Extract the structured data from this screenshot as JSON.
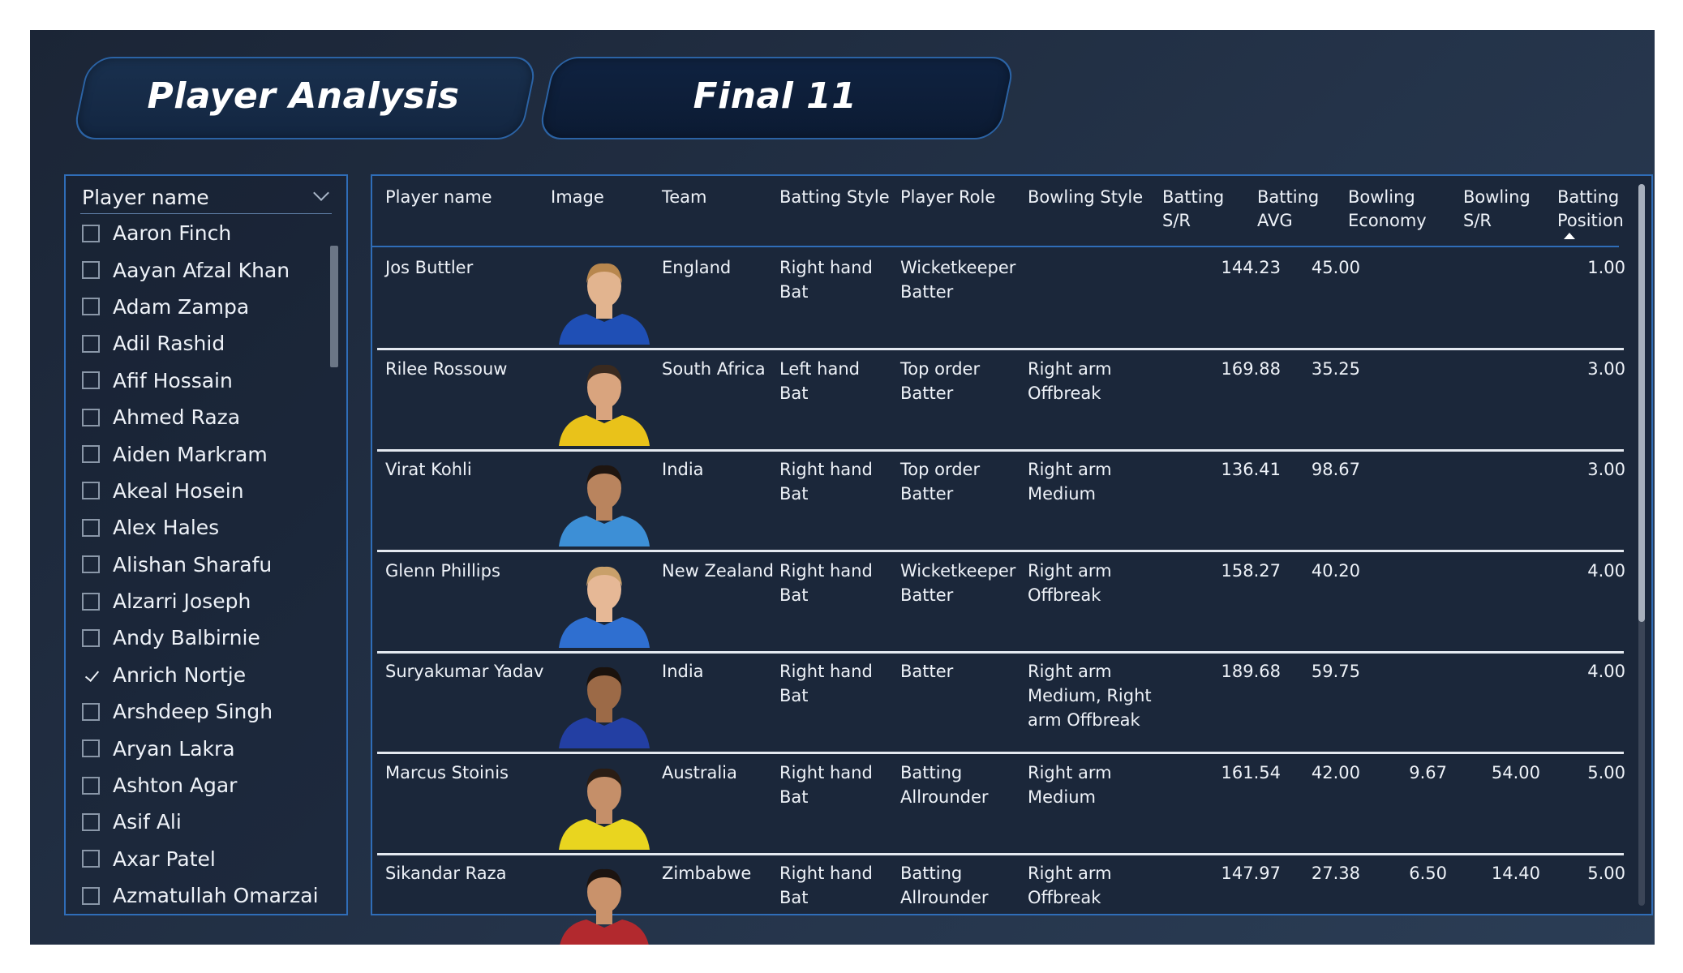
{
  "tabs": [
    {
      "label": "Player Analysis"
    },
    {
      "label": "Final 11"
    }
  ],
  "slicer": {
    "title": "Player name",
    "items": [
      {
        "label": "Aaron Finch",
        "checked": false
      },
      {
        "label": "Aayan Afzal Khan",
        "checked": false
      },
      {
        "label": "Adam Zampa",
        "checked": false
      },
      {
        "label": "Adil Rashid",
        "checked": false
      },
      {
        "label": "Afif Hossain",
        "checked": false
      },
      {
        "label": "Ahmed Raza",
        "checked": false
      },
      {
        "label": "Aiden Markram",
        "checked": false
      },
      {
        "label": "Akeal Hosein",
        "checked": false
      },
      {
        "label": "Alex Hales",
        "checked": false
      },
      {
        "label": "Alishan Sharafu",
        "checked": false
      },
      {
        "label": "Alzarri Joseph",
        "checked": false
      },
      {
        "label": "Andy Balbirnie",
        "checked": false
      },
      {
        "label": "Anrich Nortje",
        "checked": true
      },
      {
        "label": "Arshdeep Singh",
        "checked": false
      },
      {
        "label": "Aryan Lakra",
        "checked": false
      },
      {
        "label": "Ashton Agar",
        "checked": false
      },
      {
        "label": "Asif Ali",
        "checked": false
      },
      {
        "label": "Axar Patel",
        "checked": false
      },
      {
        "label": "Azmatullah Omarzai",
        "checked": false
      }
    ]
  },
  "table": {
    "columns": [
      [
        "Player name"
      ],
      [
        "Image"
      ],
      [
        "Team"
      ],
      [
        "Batting Style"
      ],
      [
        "Player Role"
      ],
      [
        "Bowling Style"
      ],
      [
        "Batting",
        "S/R"
      ],
      [
        "Batting",
        "AVG"
      ],
      [
        "Bowling",
        "Economy"
      ],
      [
        "Bowling",
        "S/R"
      ],
      [
        "Batting",
        "Position"
      ]
    ],
    "rows": [
      {
        "name": "Jos Buttler",
        "team": "England",
        "bat_style": [
          "Right hand",
          "Bat"
        ],
        "role": [
          "Wicketkeeper",
          "Batter"
        ],
        "bowl_style": [],
        "bat_sr": "144.23",
        "bat_avg": "45.00",
        "bowl_econ": "",
        "bowl_sr": "",
        "bat_pos": "1.00",
        "shirt": "#1f4fb5",
        "skin": "#e2b48f",
        "hair": "#b8874e"
      },
      {
        "name": "Rilee Rossouw",
        "team": "South Africa",
        "bat_style": [
          "Left hand",
          "Bat"
        ],
        "role": [
          "Top order",
          "Batter"
        ],
        "bowl_style": [
          "Right arm",
          "Offbreak"
        ],
        "bat_sr": "169.88",
        "bat_avg": "35.25",
        "bowl_econ": "",
        "bowl_sr": "",
        "bat_pos": "3.00",
        "shirt": "#e9c21a",
        "skin": "#d9a47e",
        "hair": "#3a2a1f"
      },
      {
        "name": "Virat Kohli",
        "team": "India",
        "bat_style": [
          "Right hand",
          "Bat"
        ],
        "role": [
          "Top order",
          "Batter"
        ],
        "bowl_style": [
          "Right arm",
          "Medium"
        ],
        "bat_sr": "136.41",
        "bat_avg": "98.67",
        "bowl_econ": "",
        "bowl_sr": "",
        "bat_pos": "3.00",
        "shirt": "#3d8fd6",
        "skin": "#b9845e",
        "hair": "#1e1510"
      },
      {
        "name": "Glenn Phillips",
        "team": "New Zealand",
        "bat_style": [
          "Right hand",
          "Bat"
        ],
        "role": [
          "Wicketkeeper",
          "Batter"
        ],
        "bowl_style": [
          "Right arm",
          "Offbreak"
        ],
        "bat_sr": "158.27",
        "bat_avg": "40.20",
        "bowl_econ": "",
        "bowl_sr": "",
        "bat_pos": "4.00",
        "shirt": "#2f6fd0",
        "skin": "#e6b896",
        "hair": "#c9a06a"
      },
      {
        "name": "Suryakumar Yadav",
        "team": "India",
        "bat_style": [
          "Right hand",
          "Bat"
        ],
        "role": [
          "Batter"
        ],
        "bowl_style": [
          "Right arm",
          "Medium, Right",
          "arm Offbreak"
        ],
        "bat_sr": "189.68",
        "bat_avg": "59.75",
        "bowl_econ": "",
        "bowl_sr": "",
        "bat_pos": "4.00",
        "shirt": "#233fa3",
        "skin": "#9c6a47",
        "hair": "#1a120d"
      },
      {
        "name": "Marcus Stoinis",
        "team": "Australia",
        "bat_style": [
          "Right hand",
          "Bat"
        ],
        "role": [
          "Batting",
          "Allrounder"
        ],
        "bowl_style": [
          "Right arm",
          "Medium"
        ],
        "bat_sr": "161.54",
        "bat_avg": "42.00",
        "bowl_econ": "9.67",
        "bowl_sr": "54.00",
        "bat_pos": "5.00",
        "shirt": "#e9d51f",
        "skin": "#c58f69",
        "hair": "#2a1d14"
      },
      {
        "name": "Sikandar Raza",
        "team": "Zimbabwe",
        "bat_style": [
          "Right hand",
          "Bat"
        ],
        "role": [
          "Batting",
          "Allrounder"
        ],
        "bowl_style": [
          "Right arm",
          "Offbreak"
        ],
        "bat_sr": "147.97",
        "bat_avg": "27.38",
        "bowl_econ": "6.50",
        "bowl_sr": "14.40",
        "bat_pos": "5.00",
        "shirt": "#b2292e",
        "skin": "#c9926b",
        "hair": "#1c1410"
      }
    ]
  }
}
